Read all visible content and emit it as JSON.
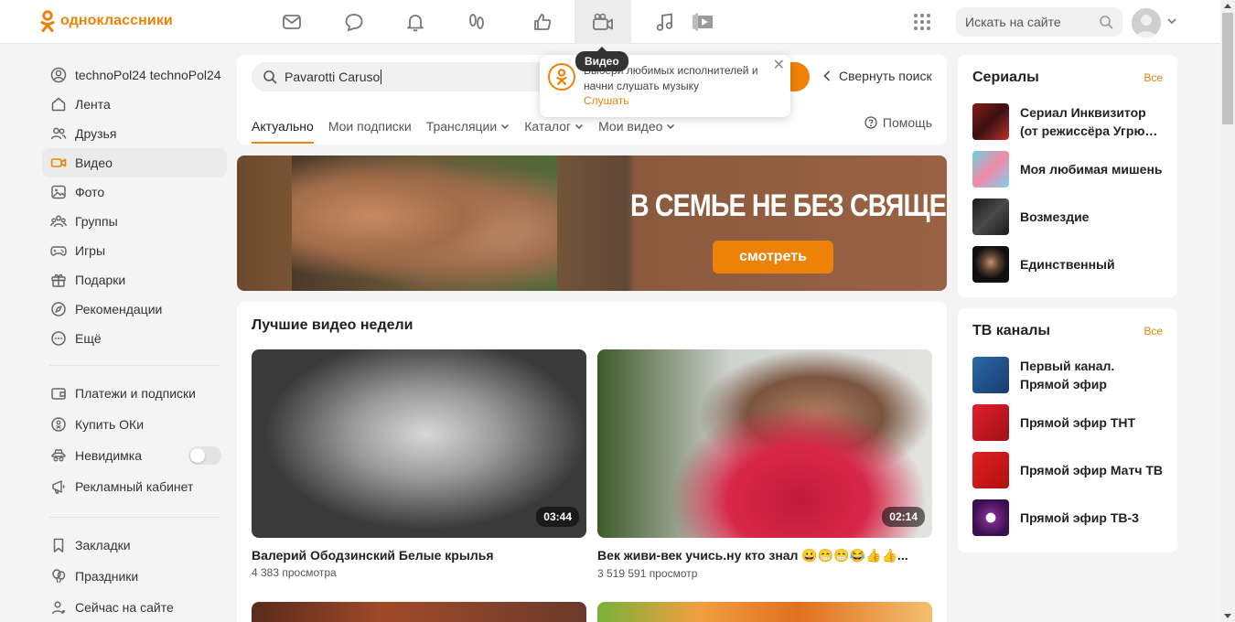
{
  "brand": {
    "name": "одноклассники",
    "color": "#ee8208"
  },
  "topbar": {
    "nav_icons": [
      "messages-icon",
      "discussions-icon",
      "notifications-icon",
      "guests-icon",
      "likes-icon",
      "video-icon",
      "music-icon",
      "games-icon"
    ],
    "active": "video-icon",
    "search_placeholder": "Искать на сайте"
  },
  "tooltip": "Видео",
  "sidebar": {
    "profile": "technoPol24 technoPol24",
    "items": [
      {
        "label": "Лента",
        "icon": "home-icon"
      },
      {
        "label": "Друзья",
        "icon": "friends-icon"
      },
      {
        "label": "Видео",
        "icon": "video-camera-icon",
        "active": true
      },
      {
        "label": "Фото",
        "icon": "photo-icon"
      },
      {
        "label": "Группы",
        "icon": "groups-icon"
      },
      {
        "label": "Игры",
        "icon": "gamepad-icon"
      },
      {
        "label": "Подарки",
        "icon": "gift-icon"
      },
      {
        "label": "Рекомендации",
        "icon": "compass-icon"
      },
      {
        "label": "Ещё",
        "icon": "more-icon"
      }
    ],
    "items2": [
      {
        "label": "Платежи и подписки",
        "icon": "wallet-icon"
      },
      {
        "label": "Купить ОКи",
        "icon": "coin-icon"
      },
      {
        "label": "Невидимка",
        "icon": "invisible-icon",
        "toggle": false
      },
      {
        "label": "Рекламный кабинет",
        "icon": "megaphone-icon"
      }
    ],
    "items3": [
      {
        "label": "Закладки",
        "icon": "bookmark-icon"
      },
      {
        "label": "Праздники",
        "icon": "balloons-icon"
      },
      {
        "label": "Сейчас на сайте",
        "icon": "online-icon"
      }
    ]
  },
  "video_search": {
    "query": "Pavarotti Caruso",
    "collapse_label": "Свернуть поиск",
    "tabs": [
      {
        "label": "Актуально",
        "active": true
      },
      {
        "label": "Мои подписки"
      },
      {
        "label": "Трансляции",
        "dropdown": true
      },
      {
        "label": "Каталог",
        "dropdown": true
      },
      {
        "label": "Мои видео",
        "dropdown": true
      }
    ],
    "help_label": "Помощь"
  },
  "music_popup": {
    "text": "Выбери любимых исполнителей и начни слушать музыку",
    "link": "Слушать"
  },
  "banner": {
    "title": "В СЕМЬЕ НЕ БЕЗ СВЯЩЕННИКА",
    "button": "смотреть"
  },
  "best_videos": {
    "title": "Лучшие видео недели",
    "items": [
      {
        "title": "Валерий Ободзинский Белые крылья",
        "views": "4 383 просмотра",
        "duration": "03:44"
      },
      {
        "title": "Век живи-век учись.ну кто знал 😀😁😁😂👍👍...",
        "views": "3 519 591 просмотр",
        "duration": "02:14"
      }
    ]
  },
  "serials": {
    "title": "Сериалы",
    "all": "Все",
    "items": [
      {
        "name": "Сериал Инквизитор (от режиссёра Угрю…"
      },
      {
        "name": "Моя любимая мишень"
      },
      {
        "name": "Возмездие"
      },
      {
        "name": "Единственный"
      }
    ]
  },
  "tv": {
    "title": "ТВ каналы",
    "all": "Все",
    "items": [
      {
        "name": "Первый канал. Прямой эфир"
      },
      {
        "name": "Прямой эфир ТНТ"
      },
      {
        "name": "Прямой эфир Матч ТВ"
      },
      {
        "name": "Прямой эфир ТВ-3"
      }
    ]
  }
}
